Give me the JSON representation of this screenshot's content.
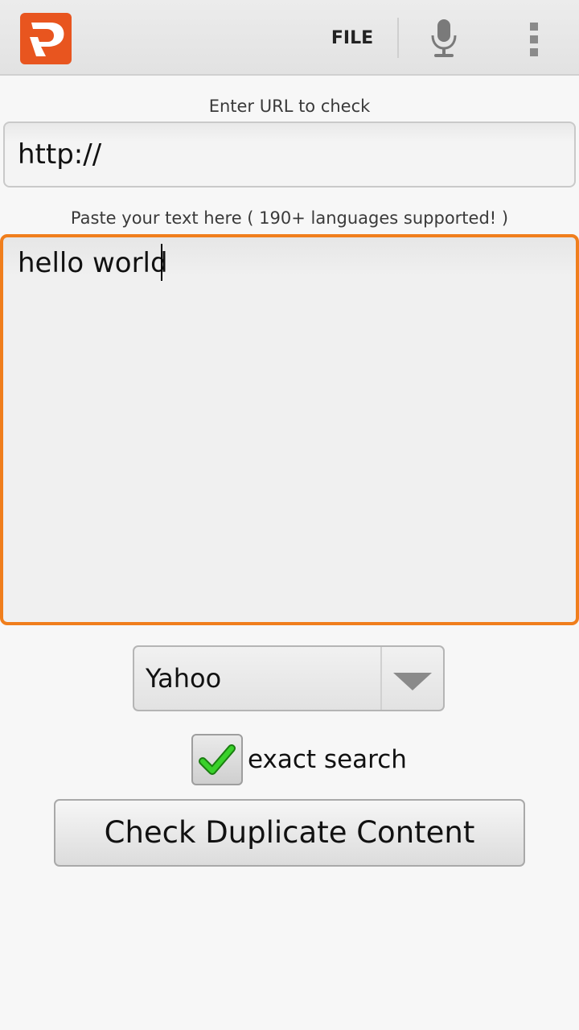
{
  "action_bar": {
    "logo_icon": "app-logo-icon",
    "file_label": "FILE",
    "mic_icon": "microphone-icon",
    "overflow_icon": "overflow-menu-icon",
    "brand_color": "#e8551f"
  },
  "url_section": {
    "label": "Enter URL to check",
    "value": "http://"
  },
  "text_section": {
    "label": "Paste your text here ( 190+ languages supported! )",
    "value": "hello world",
    "focus_color": "#f07e1c"
  },
  "engine_spinner": {
    "selected": "Yahoo"
  },
  "exact_search": {
    "label": "exact search",
    "checked": true
  },
  "check_button": {
    "label": "Check Duplicate Content"
  }
}
